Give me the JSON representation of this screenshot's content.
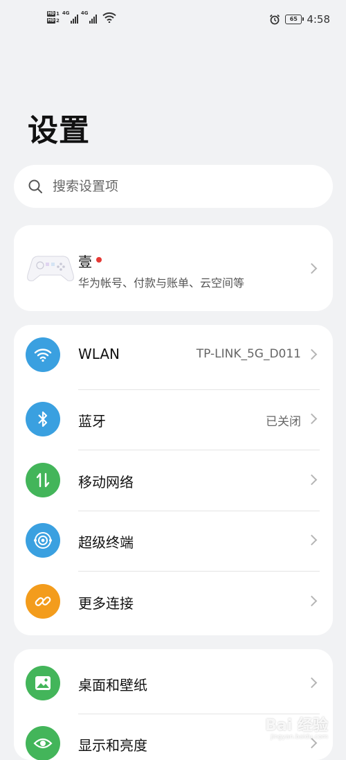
{
  "status_bar": {
    "hd1": "HD",
    "hd1_sim": "1",
    "hd2": "HD",
    "hd2_sim": "2",
    "net1": "4G",
    "net2": "4G",
    "battery": "65",
    "time": "4:58"
  },
  "title": "设置",
  "search": {
    "placeholder": "搜索设置项"
  },
  "account": {
    "name": "壹",
    "subtitle": "华为帐号、付款与账单、云空间等"
  },
  "group1": [
    {
      "label": "WLAN",
      "value": "TP-LINK_5G_D011",
      "icon": "wifi-icon",
      "color": "#3aa0e0"
    },
    {
      "label": "蓝牙",
      "value": "已关闭",
      "icon": "bluetooth-icon",
      "color": "#3aa0e0"
    },
    {
      "label": "移动网络",
      "value": "",
      "icon": "mobile-network-icon",
      "color": "#43b55a"
    },
    {
      "label": "超级终端",
      "value": "",
      "icon": "super-device-icon",
      "color": "#3aa0e0"
    },
    {
      "label": "更多连接",
      "value": "",
      "icon": "link-icon",
      "color": "#f39c1c"
    }
  ],
  "group2": [
    {
      "label": "桌面和壁纸",
      "icon": "wallpaper-icon",
      "color": "#43b55a"
    },
    {
      "label": "显示和亮度",
      "icon": "eye-icon",
      "color": "#43b55a"
    }
  ],
  "watermark": {
    "text": "Bai 经验",
    "sub": "jingyan.baidu.com"
  }
}
